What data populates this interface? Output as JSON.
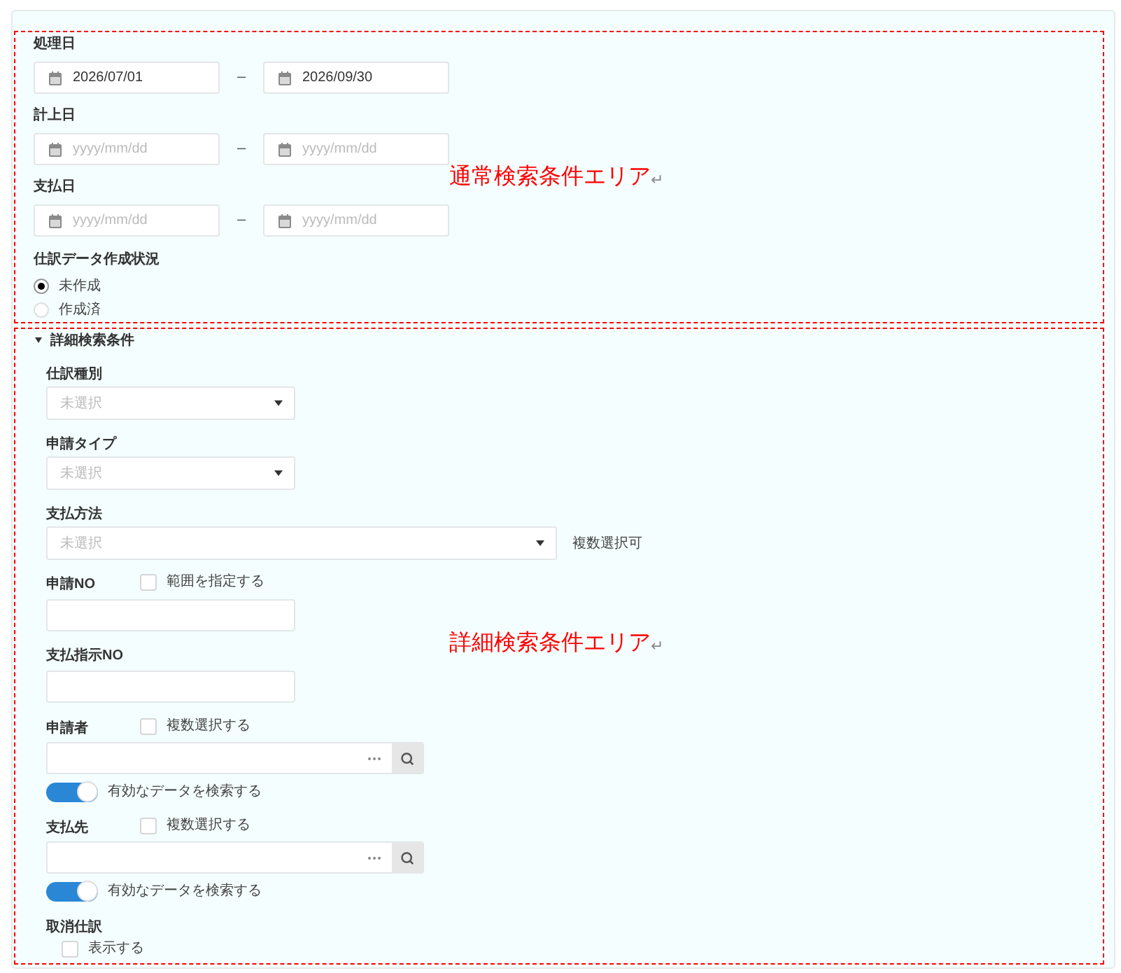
{
  "normal_area": {
    "annotation": "通常検索条件エリア",
    "annotation_mark": "↵",
    "date_ranges": [
      {
        "label": "処理日",
        "from": {
          "value": "2026/07/01"
        },
        "separator": "–",
        "to": {
          "value": "2026/09/30"
        }
      },
      {
        "label": "計上日",
        "from": {
          "placeholder": "yyyy/mm/dd"
        },
        "separator": "–",
        "to": {
          "placeholder": "yyyy/mm/dd"
        }
      },
      {
        "label": "支払日",
        "from": {
          "placeholder": "yyyy/mm/dd"
        },
        "separator": "–",
        "to": {
          "placeholder": "yyyy/mm/dd"
        }
      }
    ],
    "radio_group": {
      "label": "仕訳データ作成状況",
      "options": [
        {
          "label": "未作成",
          "selected": true
        },
        {
          "label": "作成済",
          "selected": false
        }
      ]
    }
  },
  "detail_area": {
    "title": "詳細検索条件",
    "expanded": true,
    "annotation": "詳細検索条件エリア",
    "annotation_mark": "↵",
    "fields": [
      {
        "kind": "select",
        "label": "仕訳種別",
        "placeholder": "未選択"
      },
      {
        "kind": "select",
        "label": "申請タイプ",
        "placeholder": "未選択"
      },
      {
        "kind": "select",
        "label": "支払方法",
        "placeholder": "未選択",
        "wide": true,
        "note": "複数選択可"
      },
      {
        "kind": "text",
        "label": "申請NO",
        "option": {
          "label": "範囲を指定する",
          "checked": false
        }
      },
      {
        "kind": "text",
        "label": "支払指示NO"
      },
      {
        "kind": "lookup",
        "label": "申請者",
        "option": {
          "label": "複数選択する",
          "checked": false
        },
        "toggle": {
          "label": "有効なデータを検索する",
          "on": true
        }
      },
      {
        "kind": "lookup",
        "label": "支払先",
        "option": {
          "label": "複数選択する",
          "checked": false
        },
        "toggle": {
          "label": "有効なデータを検索する",
          "on": true
        }
      },
      {
        "kind": "checkbox",
        "label": "取消仕訳",
        "option": {
          "label": "表示する",
          "checked": false
        }
      }
    ]
  }
}
